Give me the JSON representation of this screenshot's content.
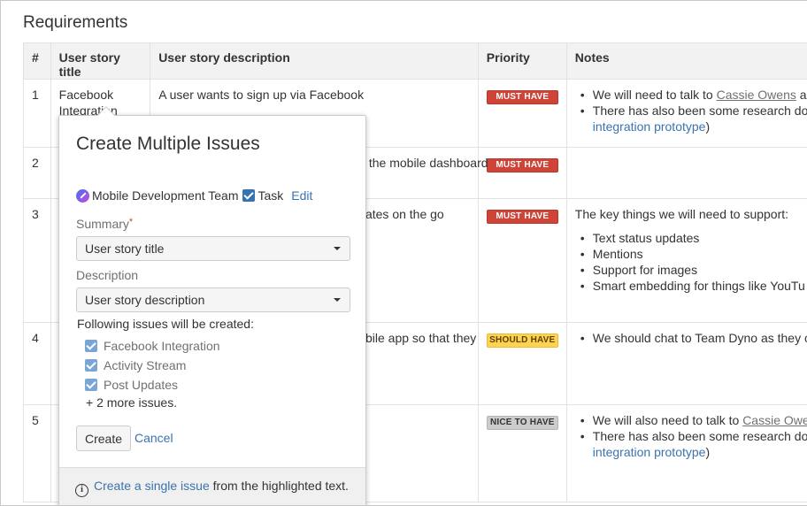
{
  "page": {
    "title": "Requirements"
  },
  "table": {
    "headers": [
      "#",
      "User story title",
      "User story description",
      "Priority",
      "Notes"
    ],
    "rows": [
      {
        "num": "1",
        "title_line1": "Facebook",
        "title_line2": "Integration",
        "description": "A user wants to sign up via Facebook",
        "priority": "MUST HAVE",
        "notes": {
          "b1_pre": "We will need to talk to ",
          "b1_link": "Cassie Owens",
          "b1_post": " a",
          "b2": "There has also been some research do",
          "b2_link": "integration prototype",
          "b2_post": ")"
        }
      },
      {
        "num": "2",
        "description": "a the mobile dashboard",
        "priority": "MUST HAVE"
      },
      {
        "num": "3",
        "description": "dates on the go",
        "priority": "MUST HAVE",
        "notes": {
          "intro": "The key things we will need to support:",
          "items": [
            "Text status updates",
            "Mentions",
            "Support for images",
            "Smart embedding for things like YouTu"
          ]
        }
      },
      {
        "num": "4",
        "description": "obile app so that they",
        "priority": "SHOULD HAVE",
        "notes": {
          "b1": "We should chat to Team Dyno as they c"
        }
      },
      {
        "num": "5",
        "priority": "NICE TO HAVE",
        "notes": {
          "b1_pre": "We will also need to talk to ",
          "b1_link": "Cassie Owe",
          "b2": "There has also been some research do",
          "b2_link": "integration prototype",
          "b2_post": ")"
        }
      }
    ]
  },
  "dialog": {
    "title": "Create Multiple Issues",
    "project": "Mobile Development Team",
    "issue_type": "Task",
    "edit_label": "Edit",
    "summary_label": "Summary",
    "summary_required": "*",
    "summary_value": "User story title",
    "description_label": "Description",
    "description_value": "User story description",
    "following_label": "Following issues will be created:",
    "issues": [
      "Facebook Integration",
      "Activity Stream",
      "Post Updates"
    ],
    "more": "+ 2 more issues.",
    "create_label": "Create",
    "cancel_label": "Cancel",
    "footer_link": "Create a single issue",
    "footer_text": " from the highlighted text.",
    "info_glyph": "i"
  },
  "colors": {
    "must_have": "#d04437",
    "should_have": "#ffd351",
    "nice_to_have": "#cccccc",
    "link": "#3b73af",
    "checkbox": "#3572b0"
  }
}
